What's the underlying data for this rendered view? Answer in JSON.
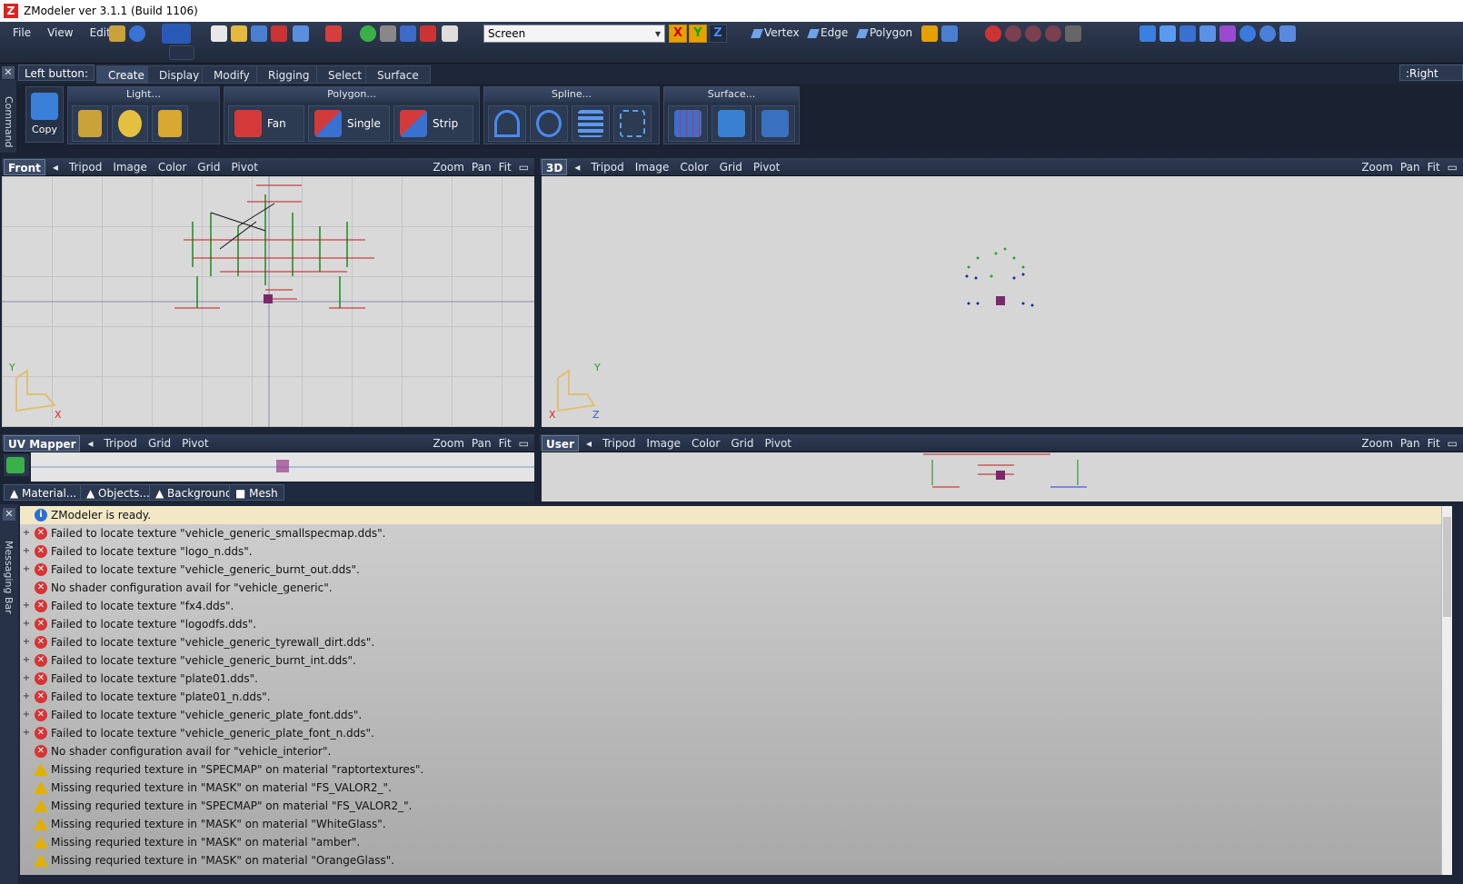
{
  "window": {
    "title": "ZModeler ver 3.1.1 (Build 1106)"
  },
  "menu": [
    "File",
    "View",
    "Edit"
  ],
  "toolbar": {
    "coord_space": "Screen",
    "axes": [
      "X",
      "Y",
      "Z"
    ],
    "modes": [
      "Vertex",
      "Edge",
      "Polygon"
    ]
  },
  "command_bar": {
    "left_label": "Left button:",
    "right_label": ":Right button",
    "side_label": "Command",
    "tabs": [
      "Create",
      "Display",
      "Modify",
      "Rigging",
      "Select",
      "Surface"
    ],
    "active_tab": "Create",
    "copy_label": "Copy",
    "groups": [
      {
        "title": "Light..."
      },
      {
        "title": "Polygon...",
        "buttons": [
          "Fan",
          "Single",
          "Strip"
        ]
      },
      {
        "title": "Spline..."
      },
      {
        "title": "Surface..."
      }
    ]
  },
  "viewports": {
    "front": {
      "name": "Front",
      "items": [
        "Tripod",
        "Image",
        "Color",
        "Grid",
        "Pivot"
      ],
      "right": [
        "Zoom",
        "Pan",
        "Fit"
      ],
      "axis_y": "Y",
      "axis_x": "X"
    },
    "persp": {
      "name": "3D",
      "items": [
        "Tripod",
        "Image",
        "Color",
        "Grid",
        "Pivot"
      ],
      "right": [
        "Zoom",
        "Pan",
        "Fit"
      ],
      "axis_y": "Y",
      "axis_x": "X",
      "axis_z": "Z"
    },
    "uv": {
      "name": "UV Mapper",
      "items": [
        "Tripod",
        "Grid",
        "Pivot"
      ],
      "right": [
        "Zoom",
        "Pan",
        "Fit"
      ],
      "panels": [
        "Material...",
        "Objects...",
        "Background",
        "Mesh"
      ]
    },
    "user": {
      "name": "User",
      "items": [
        "Tripod",
        "Image",
        "Color",
        "Grid",
        "Pivot"
      ],
      "right": [
        "Zoom",
        "Pan",
        "Fit"
      ]
    }
  },
  "messaging": {
    "side_label": "Messaging Bar",
    "messages": [
      {
        "type": "info",
        "exp": "",
        "text": "ZModeler is ready."
      },
      {
        "type": "err",
        "exp": "+",
        "text": "Failed to locate texture \"vehicle_generic_smallspecmap.dds\"."
      },
      {
        "type": "err",
        "exp": "+",
        "text": "Failed to locate texture \"logo_n.dds\"."
      },
      {
        "type": "err",
        "exp": "+",
        "text": "Failed to locate texture \"vehicle_generic_burnt_out.dds\"."
      },
      {
        "type": "err",
        "exp": "",
        "text": "No shader configuration avail for \"vehicle_generic\"."
      },
      {
        "type": "err",
        "exp": "+",
        "text": "Failed to locate texture \"fx4.dds\"."
      },
      {
        "type": "err",
        "exp": "+",
        "text": "Failed to locate texture \"logodfs.dds\"."
      },
      {
        "type": "err",
        "exp": "+",
        "text": "Failed to locate texture \"vehicle_generic_tyrewall_dirt.dds\"."
      },
      {
        "type": "err",
        "exp": "+",
        "text": "Failed to locate texture \"vehicle_generic_burnt_int.dds\"."
      },
      {
        "type": "err",
        "exp": "+",
        "text": "Failed to locate texture \"plate01.dds\"."
      },
      {
        "type": "err",
        "exp": "+",
        "text": "Failed to locate texture \"plate01_n.dds\"."
      },
      {
        "type": "err",
        "exp": "+",
        "text": "Failed to locate texture \"vehicle_generic_plate_font.dds\"."
      },
      {
        "type": "err",
        "exp": "+",
        "text": "Failed to locate texture \"vehicle_generic_plate_font_n.dds\"."
      },
      {
        "type": "err",
        "exp": "",
        "text": "No shader configuration avail for \"vehicle_interior\"."
      },
      {
        "type": "warn",
        "exp": "",
        "text": "Missing requried texture in \"SPECMAP\" on material \"raptortextures\"."
      },
      {
        "type": "warn",
        "exp": "",
        "text": "Missing requried texture in \"MASK\" on material \"FS_VALOR2_\"."
      },
      {
        "type": "warn",
        "exp": "",
        "text": "Missing requried texture in \"SPECMAP\" on material \"FS_VALOR2_\"."
      },
      {
        "type": "warn",
        "exp": "",
        "text": "Missing requried texture in \"MASK\" on material \"WhiteGlass\"."
      },
      {
        "type": "warn",
        "exp": "",
        "text": "Missing requried texture in \"MASK\" on material \"amber\"."
      },
      {
        "type": "warn",
        "exp": "",
        "text": "Missing requried texture in \"MASK\" on material \"OrangeGlass\"."
      }
    ]
  }
}
